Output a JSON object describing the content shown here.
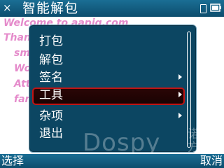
{
  "title_bar": {
    "close_glyph": "×",
    "app_title": "智能解包",
    "sim_icon": "sim-icon",
    "battery_icon": "battery-icon"
  },
  "background_lines": [
    "Welcome to aapig.com",
    "Thanks",
    "sma",
    "Wo",
    "Atta",
    "fam"
  ],
  "menu": {
    "items": [
      {
        "label": "打包",
        "has_submenu": false,
        "selected": false
      },
      {
        "label": "解包",
        "has_submenu": false,
        "selected": false
      },
      {
        "label": "签名",
        "has_submenu": true,
        "selected": false
      },
      {
        "label": "工具",
        "has_submenu": true,
        "selected": true
      },
      {
        "label": "杂项",
        "has_submenu": true,
        "selected": false
      },
      {
        "label": "退出",
        "has_submenu": false,
        "selected": false
      }
    ]
  },
  "watermark": {
    "text": "Dospy",
    "cn_text": "诺亚方"
  },
  "softkeys": {
    "left": "选择",
    "right": "取消"
  },
  "colors": {
    "bar": "#0d4d6d",
    "menu_bg": "#0c4662",
    "selected_border": "#c11414",
    "background_text": "#e58bcb"
  }
}
